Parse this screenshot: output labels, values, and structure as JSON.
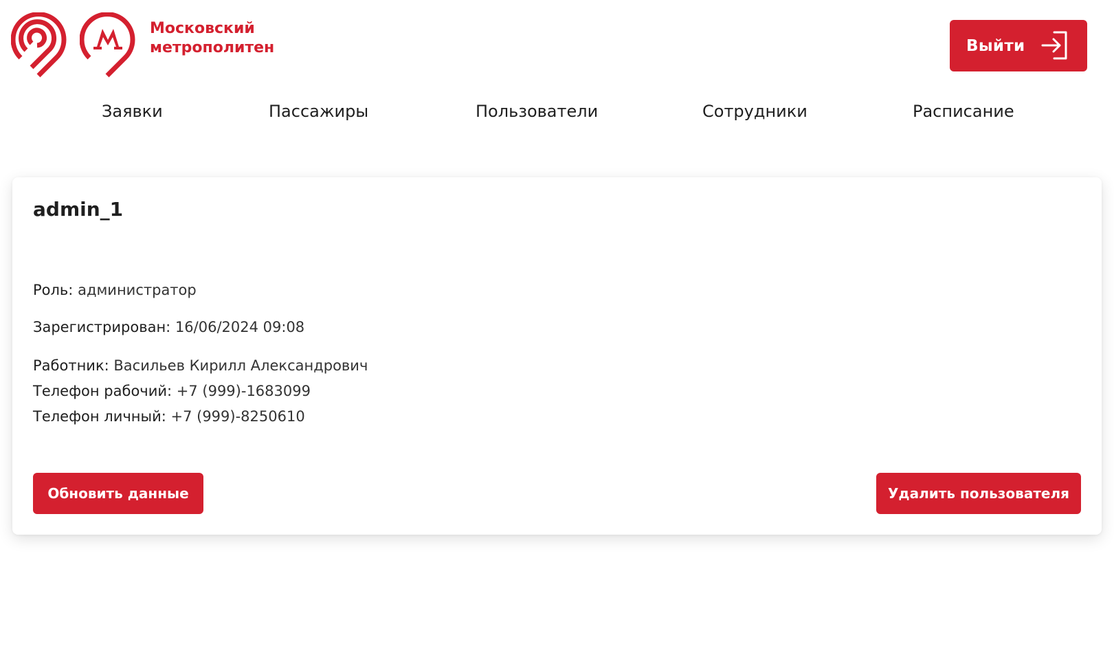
{
  "brand": {
    "line1": "Московский",
    "line2": "метрополитен",
    "accent_color": "#d4202f"
  },
  "header": {
    "logout_label": "Выйти",
    "logout_icon": "logout-arrow-icon"
  },
  "nav": {
    "items": [
      {
        "label": "Заявки"
      },
      {
        "label": "Пассажиры"
      },
      {
        "label": "Пользователи"
      },
      {
        "label": "Сотрудники"
      },
      {
        "label": "Расписание"
      }
    ]
  },
  "user": {
    "username": "admin_1",
    "role_label": "Роль:",
    "role_value": "администратор",
    "registered_label": "Зарегистрирован:",
    "registered_value": "16/06/2024 09:08",
    "worker_label": "Работник:",
    "worker_value": "Васильев Кирилл Александрович",
    "work_phone_label": "Телефон рабочий:",
    "work_phone_value": "+7 (999)-1683099",
    "personal_phone_label": "Телефон личный:",
    "personal_phone_value": "+7 (999)-8250610"
  },
  "actions": {
    "update_label": "Обновить данные",
    "delete_label": "Удалить пользователя"
  }
}
